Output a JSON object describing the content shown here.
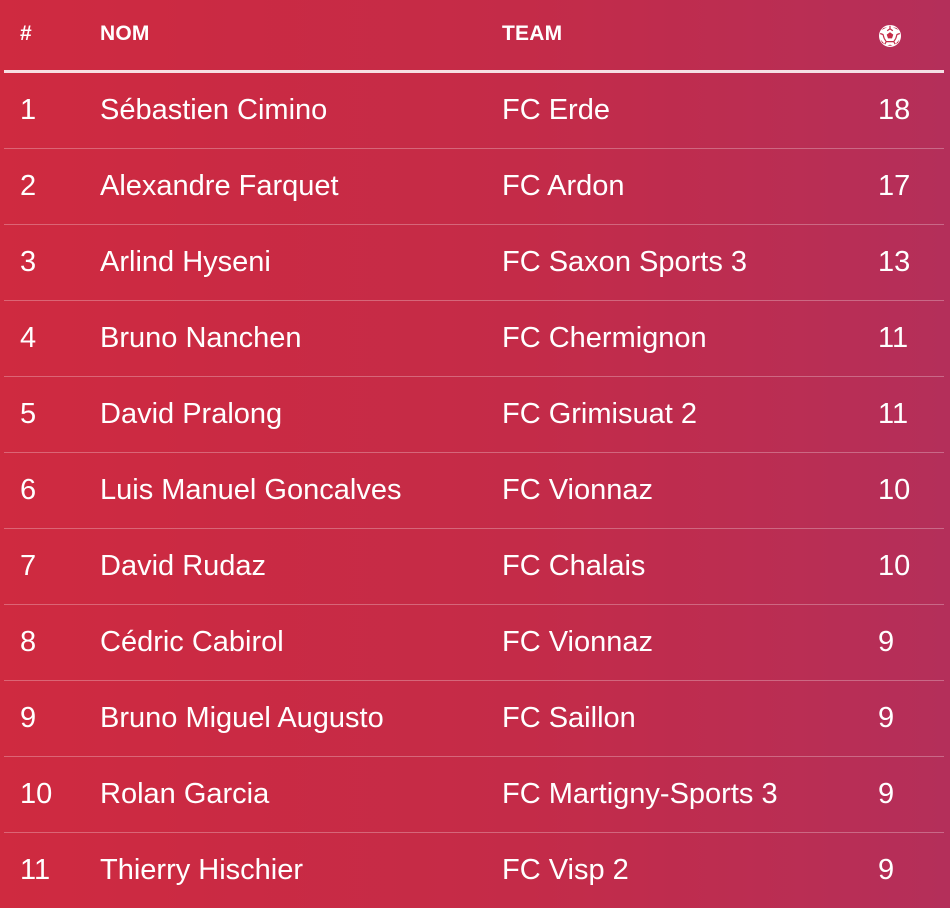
{
  "header": {
    "rank_label": "#",
    "name_label": "NOM",
    "team_label": "TEAM",
    "goals_icon": "soccer-ball-icon"
  },
  "colors": {
    "background_start": "#cf2a40",
    "background_end": "#b42f5a",
    "text": "#ffffff"
  },
  "rows": [
    {
      "rank": "1",
      "name": "Sébastien Cimino",
      "team": "FC Erde",
      "goals": "18"
    },
    {
      "rank": "2",
      "name": "Alexandre Farquet",
      "team": "FC Ardon",
      "goals": "17"
    },
    {
      "rank": "3",
      "name": "Arlind Hyseni",
      "team": "FC Saxon Sports 3",
      "goals": "13"
    },
    {
      "rank": "4",
      "name": "Bruno Nanchen",
      "team": "FC Chermignon",
      "goals": "11"
    },
    {
      "rank": "5",
      "name": "David Pralong",
      "team": "FC Grimisuat 2",
      "goals": "11"
    },
    {
      "rank": "6",
      "name": "Luis Manuel Goncalves",
      "team": "FC Vionnaz",
      "goals": "10"
    },
    {
      "rank": "7",
      "name": "David Rudaz",
      "team": "FC Chalais",
      "goals": "10"
    },
    {
      "rank": "8",
      "name": "Cédric Cabirol",
      "team": "FC Vionnaz",
      "goals": "9"
    },
    {
      "rank": "9",
      "name": "Bruno Miguel Augusto",
      "team": "FC Saillon",
      "goals": "9"
    },
    {
      "rank": "10",
      "name": "Rolan Garcia",
      "team": "FC Martigny-Sports 3",
      "goals": "9"
    },
    {
      "rank": "11",
      "name": "Thierry Hischier",
      "team": "FC Visp 2",
      "goals": "9"
    }
  ]
}
